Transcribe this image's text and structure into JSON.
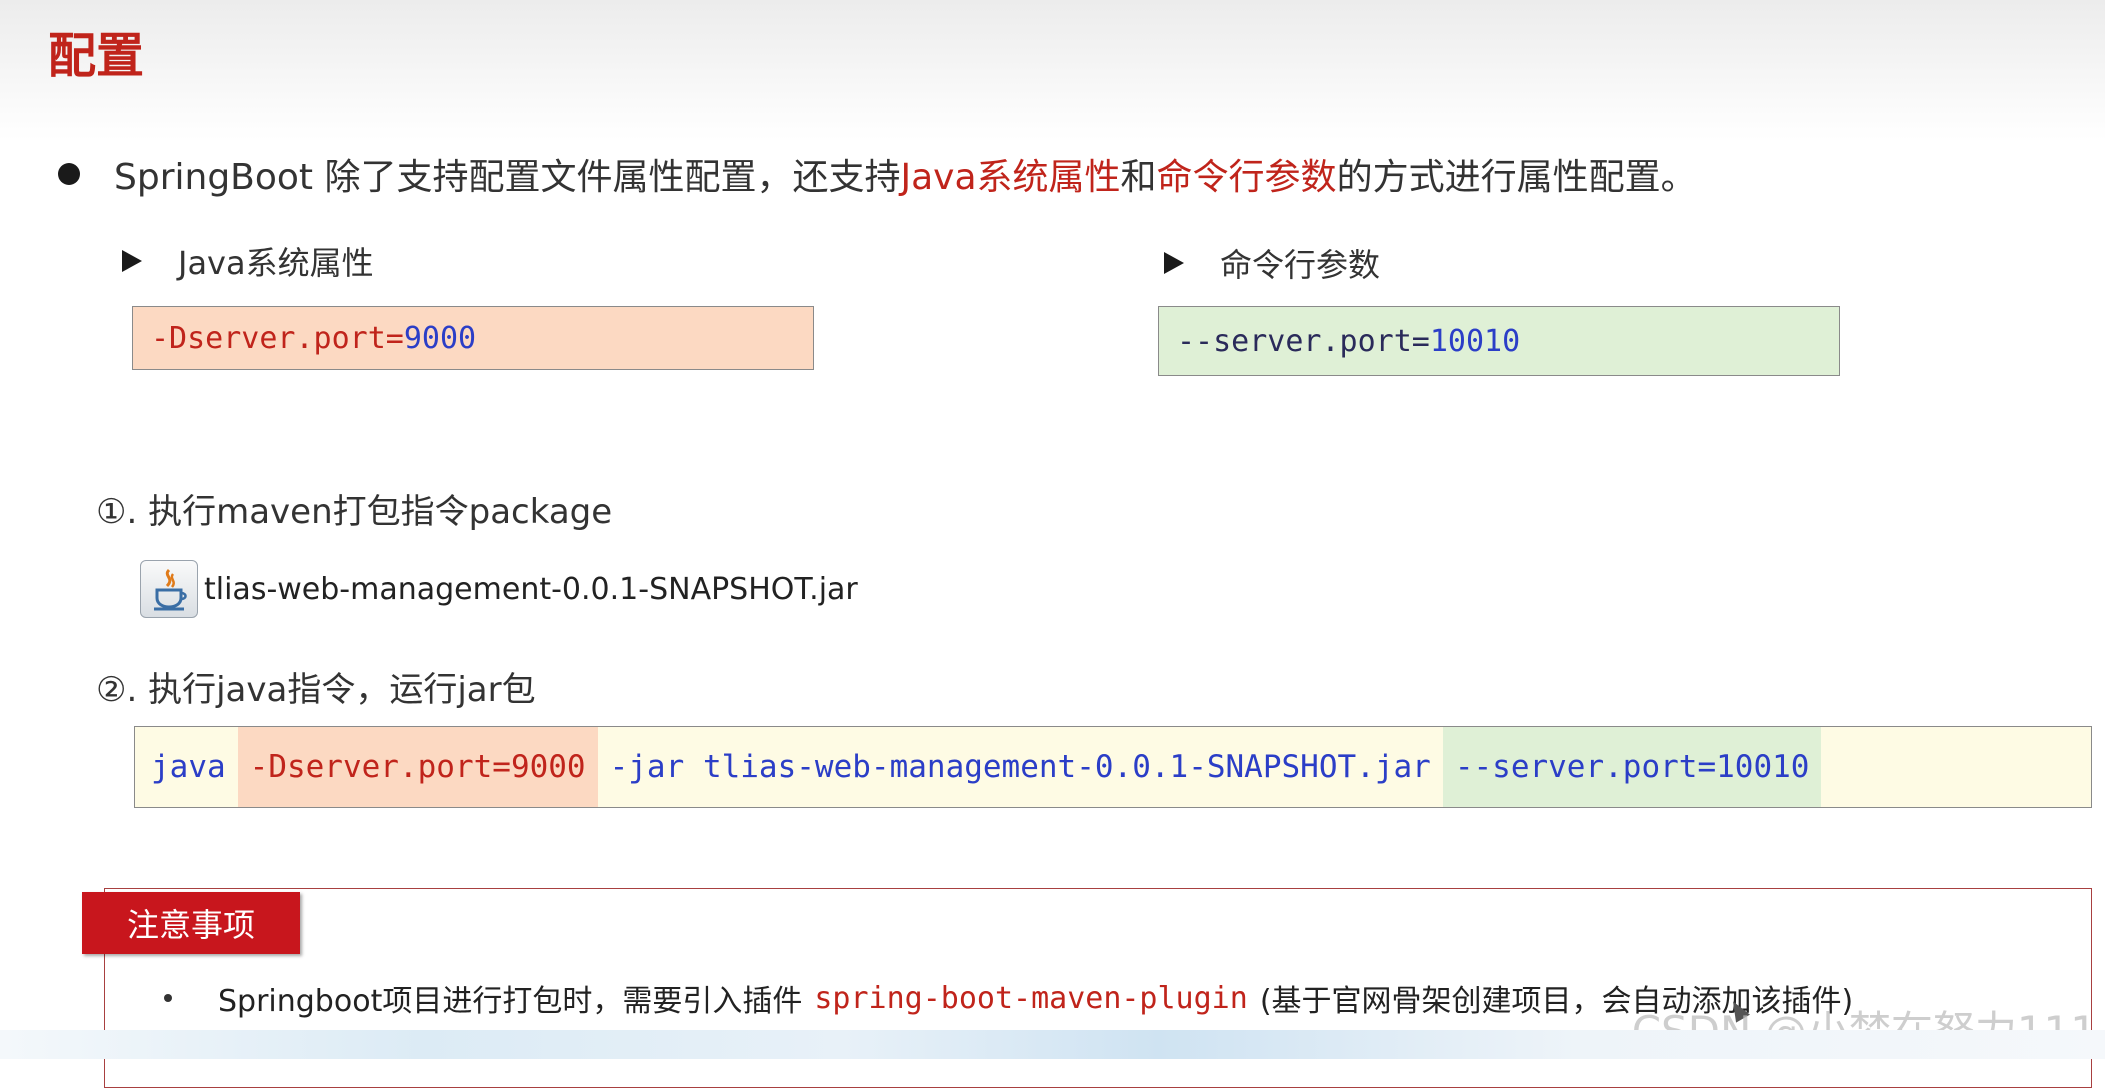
{
  "title": "配置",
  "bullet": {
    "part1": "SpringBoot 除了支持配置文件属性配置，还支持",
    "hl1": "Java系统属性",
    "mid": "和",
    "hl2": "命令行参数",
    "part2": "的方式进行属性配置。"
  },
  "java_sys": {
    "label": "Java系统属性",
    "code_key": "-Dserver.port=",
    "code_val": "9000"
  },
  "cmd_args": {
    "label": "命令行参数",
    "code_key": "--server.port=",
    "code_val": "10010"
  },
  "step1": {
    "label": "①. 执行maven打包指令package",
    "jar_file": "tlias-web-management-0.0.1-SNAPSHOT.jar",
    "jar_icon": "java-jar-icon"
  },
  "step2": {
    "label": "②. 执行java指令，运行jar包",
    "cmd_java": "java",
    "cmd_d": "-Dserver.port=9000",
    "cmd_jar_flag": "-jar",
    "cmd_jar_file": "tlias-web-management-0.0.1-SNAPSHOT.jar",
    "cmd_server": "--server.port=10010"
  },
  "note": {
    "tag": "注意事项",
    "text_before": "Springboot项目进行打包时，需要引入插件",
    "plugin": "spring-boot-maven-plugin",
    "text_after": "(基于官网骨架创建项目，会自动添加该插件)"
  },
  "watermark": "CSDN @小梦在努力111",
  "colors": {
    "accent_red": "#c0241b",
    "code_blue": "#2b3ec7",
    "peach": "#fcd9c2",
    "green": "#dff0d6",
    "cream": "#fefbe4"
  }
}
